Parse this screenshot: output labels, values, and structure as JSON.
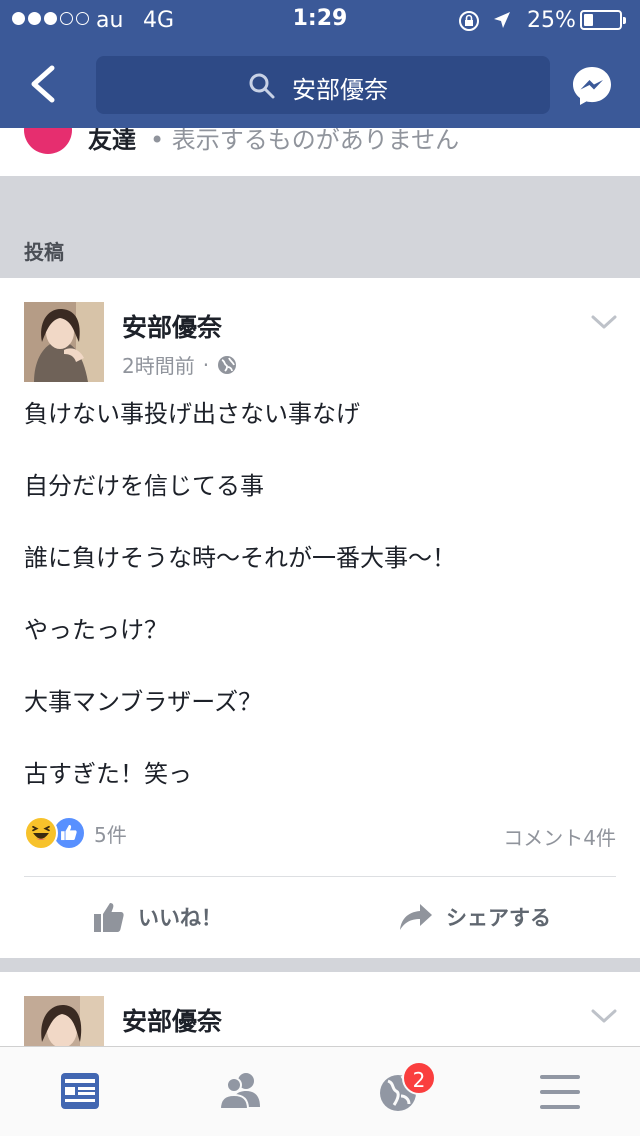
{
  "status_bar": {
    "carrier": "au",
    "network": "4G",
    "time": "1:29",
    "battery_percent": "25%",
    "signal_bars_filled": 3,
    "signal_bars_total": 5,
    "battery_level": 0.25
  },
  "header": {
    "search_text": "安部優奈",
    "color": "#3b5998"
  },
  "friends_row": {
    "label": "友達",
    "subtext": "• 表示するものがありません"
  },
  "posts_section": {
    "label": "投稿"
  },
  "post": {
    "author": "安部優奈",
    "time": "2時間前",
    "separator": "·",
    "audience_icon": "globe-icon",
    "lines": [
      "負けない事投げ出さない事なげ",
      "自分だけを信じてる事",
      "誰に負けそうな時〜それが一番大事〜！",
      "やったっけ？",
      "大事マンブラザーズ？",
      "古すぎた！笑っ"
    ],
    "reaction_count": "5件",
    "comments": "コメント4件",
    "like_label": "いいね！",
    "share_label": "シェアする"
  },
  "post2": {
    "author": "安部優奈"
  },
  "tabbar": {
    "tabs": [
      "news-feed-icon",
      "friends-icon",
      "notifications-globe-icon",
      "menu-icon"
    ],
    "notifications_badge": "2",
    "active_color": "#4267b2"
  }
}
